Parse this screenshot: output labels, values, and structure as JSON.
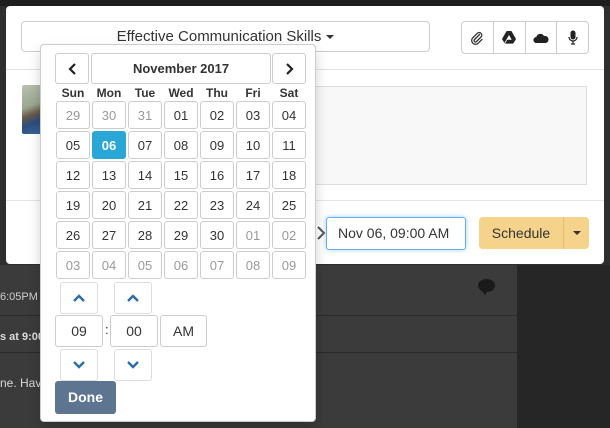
{
  "modal": {
    "title": "Effective Communication Skills",
    "tools": [
      {
        "icon": "paperclip-icon"
      },
      {
        "icon": "google-drive-icon"
      },
      {
        "icon": "onedrive-cloud-icon"
      },
      {
        "icon": "microphone-icon"
      }
    ],
    "schedule_value": "Nov 06, 09:00 AM",
    "schedule_label": "Schedule",
    "colors": {
      "schedule_bg": "#f5d38b",
      "input_focus": "#66afe9"
    }
  },
  "datepicker": {
    "month_label": "November 2017",
    "weekdays": [
      "Sun",
      "Mon",
      "Tue",
      "Wed",
      "Thu",
      "Fri",
      "Sat"
    ],
    "weeks": [
      [
        "29",
        "30",
        "31",
        "01",
        "02",
        "03",
        "04"
      ],
      [
        "05",
        "06",
        "07",
        "08",
        "09",
        "10",
        "11"
      ],
      [
        "12",
        "13",
        "14",
        "15",
        "16",
        "17",
        "18"
      ],
      [
        "19",
        "20",
        "21",
        "22",
        "23",
        "24",
        "25"
      ],
      [
        "26",
        "27",
        "28",
        "29",
        "30",
        "01",
        "02"
      ],
      [
        "03",
        "04",
        "05",
        "06",
        "07",
        "08",
        "09"
      ]
    ],
    "selected": "06",
    "hour": "09",
    "minute": "00",
    "separator": ":",
    "meridiem": "AM",
    "done_label": "Done",
    "colors": {
      "selected_day": "#2aa7d6",
      "done_button": "#5e7591",
      "arrow": "#2e6da4"
    }
  },
  "background": {
    "time": "6:05PM",
    "bold_line": "s at 9:00",
    "message_fragment": "ne. Hav"
  }
}
